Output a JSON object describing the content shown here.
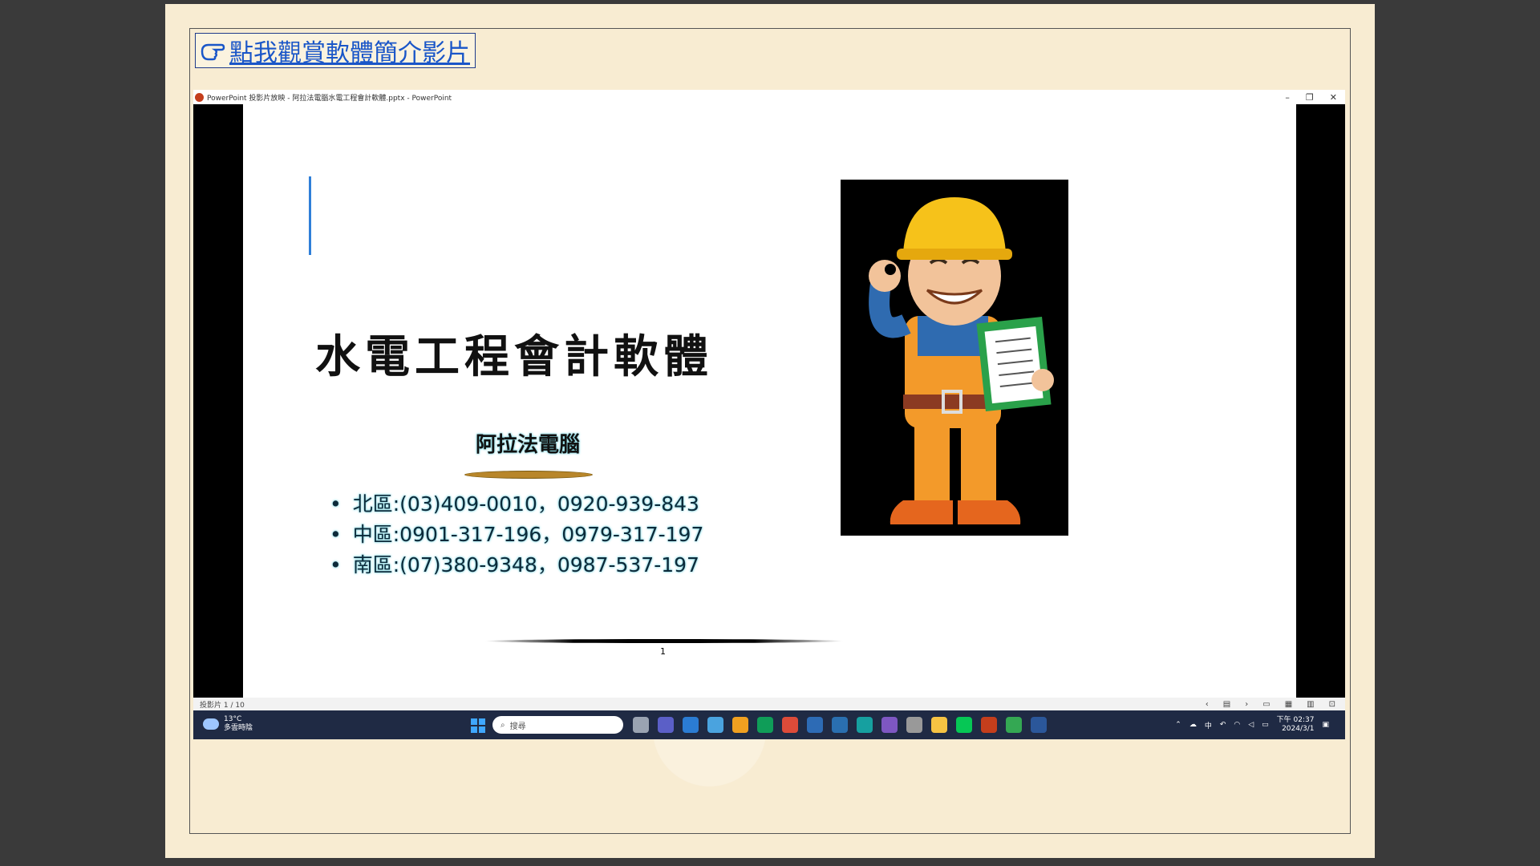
{
  "link": {
    "label": "點我觀賞軟體簡介影片"
  },
  "window": {
    "title": "PowerPoint 投影片放映  -  阿拉法電腦水電工程會計軟體.pptx - PowerPoint",
    "minimize": "–",
    "restore": "❐",
    "close": "✕"
  },
  "slide": {
    "title": "水電工程會計軟體",
    "company": "阿拉法電腦",
    "contacts": [
      "北區:(03)409-0010，0920-939-843",
      "中區:0901-317-196，0979-317-197",
      "南區:(07)380-9348，0987-537-197"
    ]
  },
  "statusbar": {
    "slide_indicator": "投影片 1 / 10",
    "prev": "‹",
    "next": "›"
  },
  "taskbar": {
    "temperature": "13°C",
    "weather": "多雲時陰",
    "search_placeholder": "搜尋",
    "ime": "中",
    "time": "下午 02:37",
    "date": "2024/3/1",
    "app_colors": [
      "#9aa3b2",
      "#5b5fc7",
      "#2b7cd3",
      "#4aa3df",
      "#f0a020",
      "#0f9d58",
      "#dd4b39",
      "#2d6bb5",
      "#2a6fb0",
      "#16a0a0",
      "#7e57c2",
      "#999999",
      "#f6c343",
      "#06c755",
      "#c43e1c",
      "#34a853",
      "#2b579a"
    ]
  },
  "page": {
    "number": "1"
  }
}
